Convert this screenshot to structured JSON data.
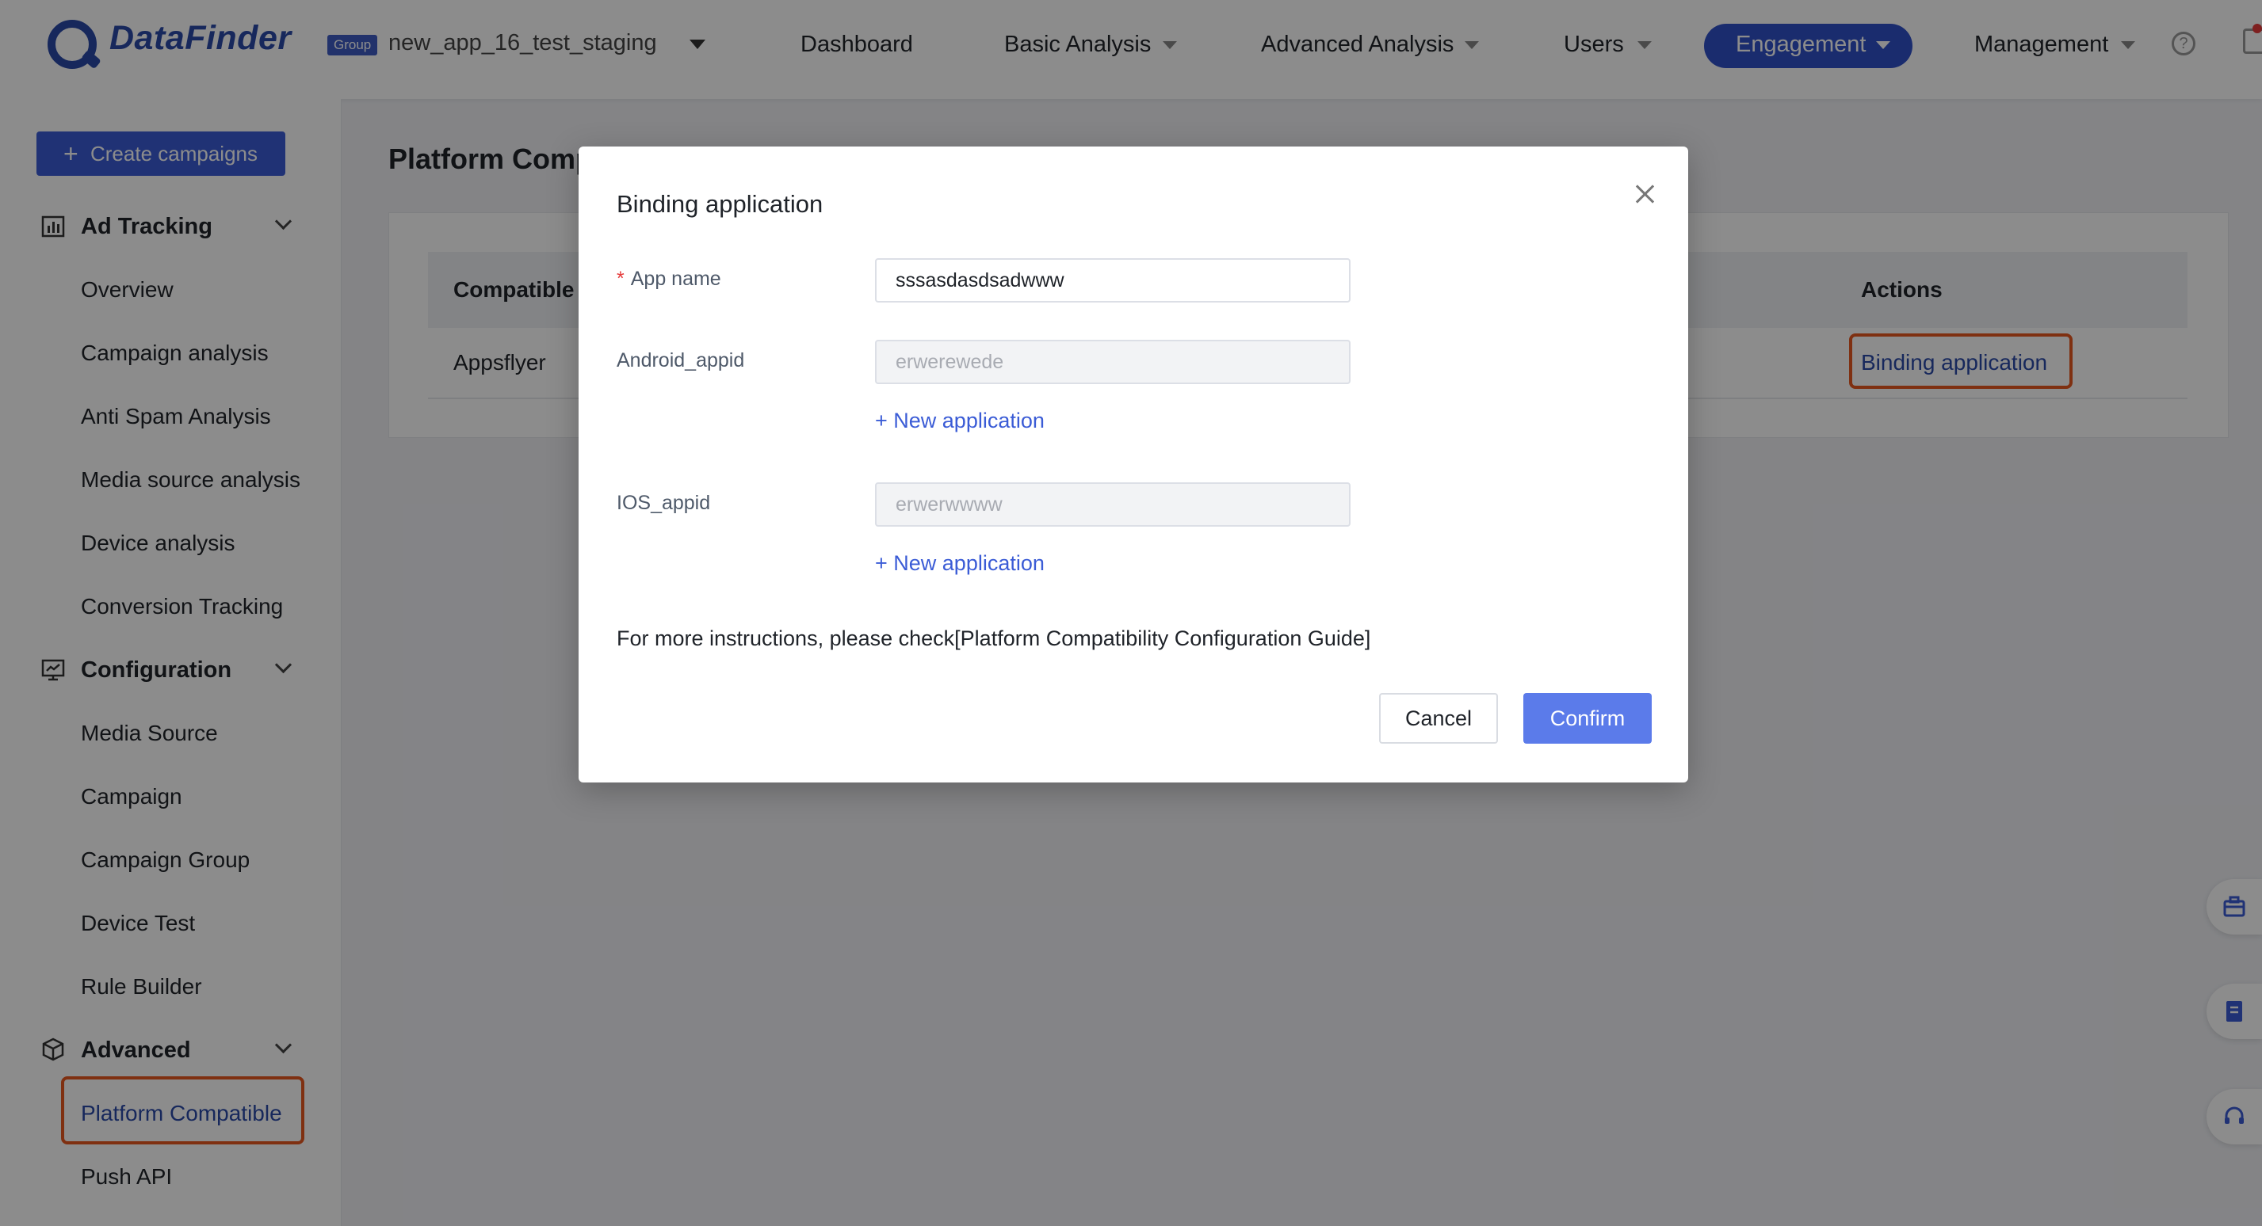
{
  "header": {
    "brand": "DataFinder",
    "group_badge": "Group",
    "app_name": "new_app_16_test_staging",
    "nav": {
      "dashboard": "Dashboard",
      "basic_analysis": "Basic Analysis",
      "advanced_analysis": "Advanced Analysis",
      "users": "Users",
      "engagement": "Engagement",
      "management": "Management"
    },
    "help": "?"
  },
  "sidebar": {
    "create_button": "Create campaigns",
    "sections": {
      "ad_tracking": {
        "title": "Ad Tracking",
        "items": [
          "Overview",
          "Campaign analysis",
          "Anti Spam Analysis",
          "Media source analysis",
          "Device analysis",
          "Conversion Tracking"
        ]
      },
      "configuration": {
        "title": "Configuration",
        "items": [
          "Media Source",
          "Campaign",
          "Campaign Group",
          "Device Test",
          "Rule Builder"
        ]
      },
      "advanced": {
        "title": "Advanced",
        "items": [
          "Platform Compatible",
          "Push API"
        ]
      }
    }
  },
  "main": {
    "page_title": "Platform Comp",
    "table": {
      "columns": [
        "Compatible p",
        "Actions"
      ],
      "rows": [
        {
          "name": "Appsflyer",
          "action": "Binding application"
        }
      ]
    }
  },
  "modal": {
    "title": "Binding application",
    "fields": {
      "app_name": {
        "label": "App name",
        "value": "sssasdasdsadwww",
        "required": "*"
      },
      "android_appid": {
        "label": "Android_appid",
        "value": "erwerewede"
      },
      "ios_appid": {
        "label": "IOS_appid",
        "value": "erwerwwww"
      }
    },
    "new_application": "+ New application",
    "guide": "For more instructions, please check[Platform Compatibility Configuration Guide]",
    "cancel": "Cancel",
    "confirm": "Confirm"
  },
  "colors": {
    "accent": "#3b5cd6",
    "highlight": "#e8581f",
    "confirm": "#5b7bea"
  }
}
